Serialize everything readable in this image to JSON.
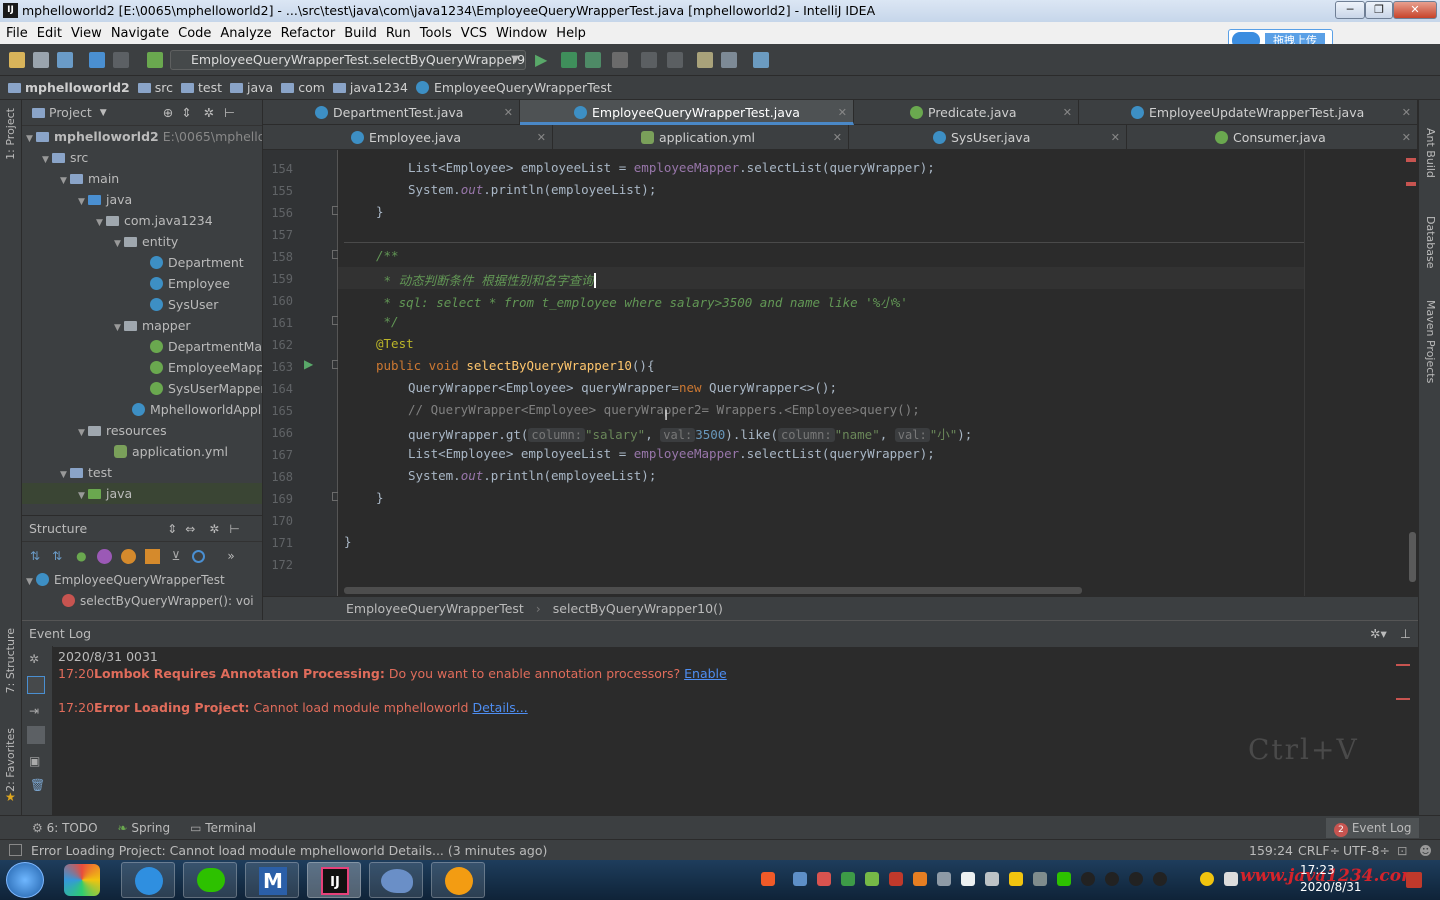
{
  "window": {
    "title": "mphelloworld2 [E:\\0065\\mphelloworld2] - ...\\src\\test\\java\\com\\java1234\\EmployeeQueryWrapperTest.java [mphelloworld2] - IntelliJ IDEA"
  },
  "menu": [
    "File",
    "Edit",
    "View",
    "Navigate",
    "Code",
    "Analyze",
    "Refactor",
    "Build",
    "Run",
    "Tools",
    "VCS",
    "Window",
    "Help"
  ],
  "toolbar": {
    "run_config": "EmployeeQueryWrapperTest.selectByQueryWrapper9"
  },
  "overlay": {
    "upload_label": "拖拽上传",
    "ime_label": "英"
  },
  "breadcrumb": [
    "mphelloworld2",
    "src",
    "test",
    "java",
    "com",
    "java1234",
    "EmployeeQueryWrapperTest"
  ],
  "project_panel": {
    "title": "Project",
    "tree": [
      {
        "label": "mphelloworld2",
        "extra": "E:\\0065\\mphello",
        "icon": "folder-icon"
      },
      {
        "label": "src",
        "icon": "folder-icon"
      },
      {
        "label": "main",
        "icon": "folder-icon"
      },
      {
        "label": "java",
        "icon": "folder-icon"
      },
      {
        "label": "com.java1234",
        "icon": "package-icon"
      },
      {
        "label": "entity",
        "icon": "package-icon"
      },
      {
        "label": "Department",
        "icon": "class-icon"
      },
      {
        "label": "Employee",
        "icon": "class-icon"
      },
      {
        "label": "SysUser",
        "icon": "class-icon"
      },
      {
        "label": "mapper",
        "icon": "package-icon"
      },
      {
        "label": "DepartmentMap",
        "icon": "interface-icon"
      },
      {
        "label": "EmployeeMappe",
        "icon": "interface-icon"
      },
      {
        "label": "SysUserMapper",
        "icon": "interface-icon"
      },
      {
        "label": "MphelloworldAppli",
        "icon": "class-icon"
      },
      {
        "label": "resources",
        "icon": "folder-icon"
      },
      {
        "label": "application.yml",
        "icon": "yml-icon"
      },
      {
        "label": "test",
        "icon": "folder-icon"
      },
      {
        "label": "java",
        "icon": "folder-icon"
      }
    ]
  },
  "structure_panel": {
    "title": "Structure",
    "class_name": "EmployeeQueryWrapperTest",
    "method": "selectByQueryWrapper(): voi"
  },
  "tabs_row1": [
    {
      "label": "DepartmentTest.java",
      "active": false
    },
    {
      "label": "EmployeeQueryWrapperTest.java",
      "active": true
    },
    {
      "label": "Predicate.java",
      "active": false
    },
    {
      "label": "EmployeeUpdateWrapperTest.java",
      "active": false
    }
  ],
  "tabs_row2": [
    {
      "label": "Employee.java"
    },
    {
      "label": "application.yml"
    },
    {
      "label": "SysUser.java"
    },
    {
      "label": "Consumer.java"
    }
  ],
  "editor": {
    "line_numbers": [
      "154",
      "155",
      "156",
      "157",
      "158",
      "159",
      "160",
      "161",
      "162",
      "163",
      "164",
      "165",
      "166",
      "167",
      "168",
      "169",
      "170",
      "171",
      "172"
    ],
    "code": {
      "l154": {
        "a": "List<Employee> employeeList = ",
        "b": "employeeMapper",
        "c": ".selectList(queryWrapper);"
      },
      "l155": {
        "a": "System.",
        "b": "out",
        "c": ".println(employeeList);"
      },
      "l156": "}",
      "l158": "/**",
      "l159": " * 动态判断条件 根据性别和名字查询",
      "l160": " * sql: select * from t_employee where salary>3500 and name like '%小%'",
      "l161": " */",
      "l162": "@Test",
      "l163": {
        "kw": "public void ",
        "fn": "selectByQueryWrapper10",
        "rest": "(){"
      },
      "l164": {
        "a": "QueryWrapper<Employee> queryWrapper=",
        "kw": "new ",
        "c": "QueryWrapper<>();"
      },
      "l165": "// QueryWrapper<Employee> queryWrapper2= Wrappers.<Employee>query();",
      "l166": {
        "a": "queryWrapper.gt(",
        "h1": "column:",
        "s1": "\"salary\"",
        "sep": ", ",
        "h2": "val:",
        "n": "3500",
        "b": ").like(",
        "h3": "column:",
        "s2": "\"name\"",
        "sep2": ", ",
        "h4": "val:",
        "s3": "\"小\"",
        "end": ");"
      },
      "l167": {
        "a": "List<Employee> employeeList = ",
        "b": "employeeMapper",
        "c": ".selectList(queryWrapper);"
      },
      "l168": {
        "a": "System.",
        "b": "out",
        "c": ".println(employeeList);"
      },
      "l169": "}",
      "l171": "}"
    },
    "breadcrumb": [
      "EmployeeQueryWrapperTest",
      "selectByQueryWrapper10()"
    ]
  },
  "event_log": {
    "title": "Event Log",
    "date": "2020/8/31 0031",
    "entries": [
      {
        "time": "17:20",
        "title": "Lombok Requires Annotation Processing:",
        "msg": " Do you want to enable annotation processors? ",
        "link": "Enable"
      },
      {
        "time": "17:20",
        "title": "Error Loading Project:",
        "msg": " Cannot load module mphelloworld ",
        "link": "Details..."
      }
    ],
    "overlay": "Ctrl+V"
  },
  "bottom_tabs": [
    "6: TODO",
    "Spring",
    "Terminal"
  ],
  "event_log_badge": {
    "label": "Event Log",
    "count": "2"
  },
  "status": {
    "message": "Error Loading Project: Cannot load module mphelloworld Details... (3 minutes ago)",
    "position": "159:24",
    "line_sep": "CRLF",
    "encoding": "UTF-8"
  },
  "side_tools": {
    "left": [
      "1: Project",
      "7: Structure",
      "2: Favorites"
    ],
    "right": [
      "Ant Build",
      "Database",
      "Maven Projects"
    ]
  },
  "taskbar": {
    "time": "17:23",
    "date": "2020/8/31",
    "watermark": "www.java1234.com"
  }
}
